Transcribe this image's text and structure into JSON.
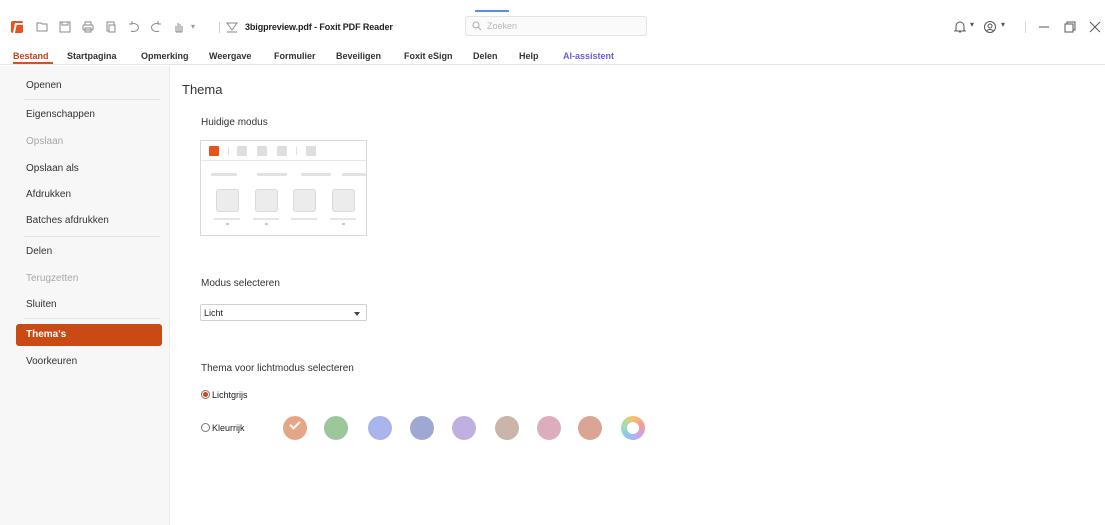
{
  "window": {
    "doc_title": "3bigpreview.pdf - Foxit PDF Reader",
    "search_placeholder": "Zoeken"
  },
  "toolbar_icons": [
    "open-icon",
    "save-icon",
    "print-icon",
    "copy-icon",
    "undo-icon",
    "redo-icon",
    "hand-icon",
    "customize-icon"
  ],
  "menu": [
    {
      "label": "Bestand",
      "active": true
    },
    {
      "label": "Startpagina"
    },
    {
      "label": "Opmerking"
    },
    {
      "label": "Weergave"
    },
    {
      "label": "Formulier"
    },
    {
      "label": "Beveiligen"
    },
    {
      "label": "Foxit eSign"
    },
    {
      "label": "Delen"
    },
    {
      "label": "Help"
    },
    {
      "label": "AI-assistent"
    }
  ],
  "nav": [
    {
      "label": "Openen"
    },
    {
      "label": "Eigenschappen"
    },
    {
      "label": "Opslaan",
      "disabled": true
    },
    {
      "label": "Opslaan als"
    },
    {
      "label": "Afdrukken"
    },
    {
      "label": "Batches afdrukken"
    },
    {
      "label": "Delen"
    },
    {
      "label": "Terugzetten",
      "disabled": true
    },
    {
      "label": "Sluiten"
    },
    {
      "label": "Thema's",
      "active": true
    },
    {
      "label": "Voorkeuren"
    }
  ],
  "main": {
    "title": "Thema",
    "current_mode_label": "Huidige modus",
    "select_mode_label": "Modus selecteren",
    "mode_value": "Licht",
    "light_theme_label": "Thema voor lichtmodus selecteren",
    "options": [
      {
        "label": "Lichtgrijs",
        "selected": true
      },
      {
        "label": "Kleurrijk",
        "selected": false
      }
    ],
    "swatches": [
      "#e6a587",
      "#9cc79d",
      "#a9b5ec",
      "#9fa8d2",
      "#bfb0df",
      "#cbb4aa",
      "#dcadbc",
      "#d9a594",
      "multicolor"
    ]
  },
  "colors": {
    "accent": "#c94a14",
    "brand_logo": "#e8531d",
    "ai_label": "#6a5cd8"
  }
}
